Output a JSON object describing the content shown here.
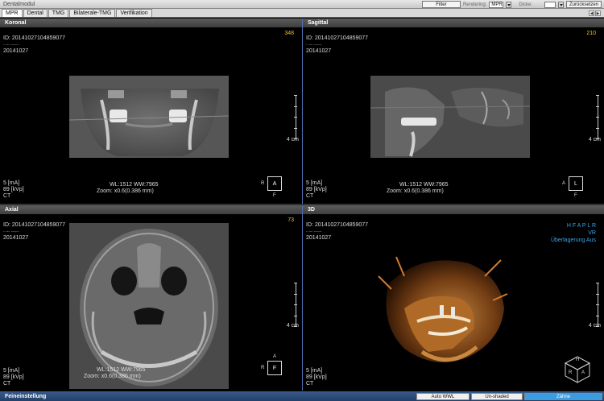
{
  "app_title": "Dentalmodul",
  "toolbar": {
    "filter_label": "Filter",
    "rendering_label": "Rendering:",
    "rendering_value": "MPR",
    "thickness_label": "Dicke:",
    "thickness_value": "",
    "reset_label": "Zurücksetzen"
  },
  "tabs": [
    "MPR",
    "Dental",
    "TMG",
    "Bilaterale-TMG",
    "Verifikation"
  ],
  "patient": {
    "id": "ID: 20141027104859077",
    "name": "- --- ------",
    "date": "20141027",
    "ma": "5 [mA]",
    "kvp": "89 [kVp]",
    "modality": "CT",
    "wl": "WL:1512 WW:7965",
    "zoom": "Zoom: x0.6(0.386 mm)",
    "scale": "4 cm"
  },
  "viewports": {
    "koronal": {
      "title": "Koronal",
      "slice": "348",
      "orient_center": "A",
      "orient_left": "R",
      "orient_bottom": "F"
    },
    "sagittal": {
      "title": "Sagittal",
      "slice": "210",
      "orient_center": "L",
      "orient_left": "A",
      "orient_bottom": "F"
    },
    "axial": {
      "title": "Axial",
      "slice": "73",
      "orient_center": "F",
      "orient_left": "R",
      "orient_top": "A"
    },
    "three_d": {
      "title": "3D",
      "orientation_letters": "H F A P L R",
      "render_mode": "VR",
      "overlay": "Überlagerung Aus",
      "cube_labels": [
        "H",
        "R",
        "A"
      ]
    }
  },
  "statusbar": {
    "title": "Feineinstellung",
    "auto_wwl": "Auto WWL",
    "unshaded": "Un-shaded",
    "teeth": "Zähne"
  },
  "colors": {
    "slice_number": "#e8c030",
    "blue_text": "#3fa4e6",
    "status_bar": "#23406a"
  }
}
